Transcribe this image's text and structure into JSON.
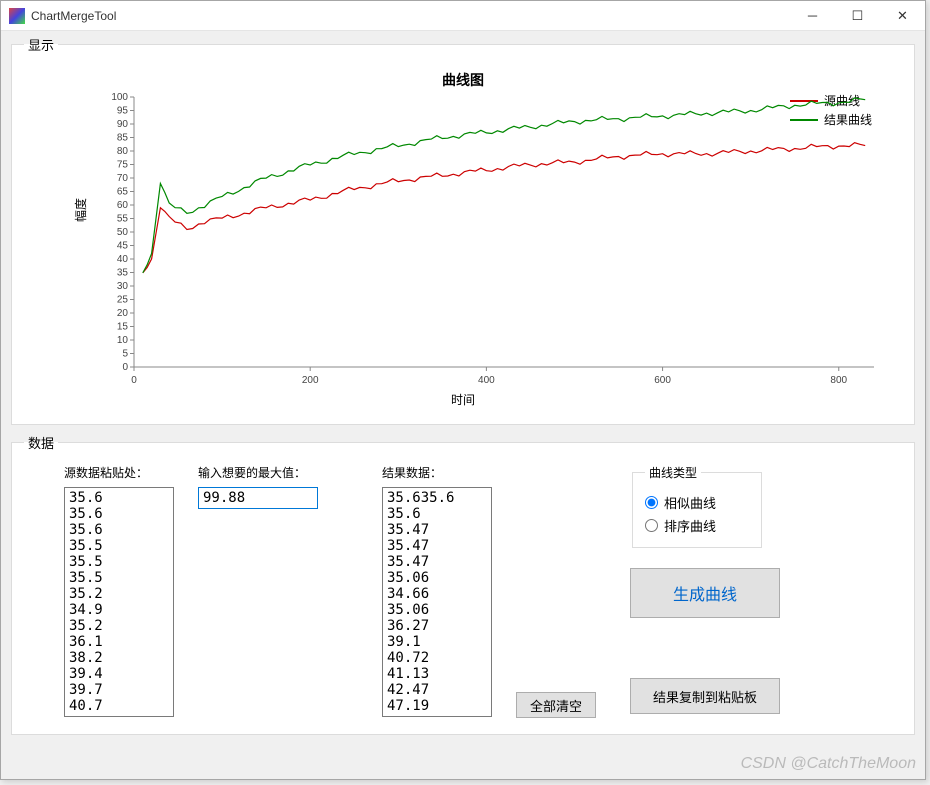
{
  "window": {
    "title": "ChartMergeTool"
  },
  "groups": {
    "display": "显示",
    "data": "数据"
  },
  "chart_data": {
    "type": "line",
    "title": "曲线图",
    "xlabel": "时间",
    "ylabel": "幅度",
    "xlim": [
      0,
      840
    ],
    "ylim": [
      0,
      100
    ],
    "x_ticks": [
      0,
      200,
      400,
      600,
      800
    ],
    "y_ticks": [
      0,
      5,
      10,
      15,
      20,
      25,
      30,
      35,
      40,
      45,
      50,
      55,
      60,
      65,
      70,
      75,
      80,
      85,
      90,
      95,
      100
    ],
    "legend": {
      "series1": "源曲线",
      "series2": "结果曲线",
      "color1": "#cc0000",
      "color2": "#008800"
    },
    "series": [
      {
        "name": "源曲线",
        "color": "#cc0000",
        "x": [
          10,
          20,
          30,
          40,
          60,
          80,
          100,
          150,
          200,
          250,
          300,
          350,
          400,
          450,
          500,
          550,
          600,
          650,
          700,
          750,
          800,
          830
        ],
        "values": [
          35,
          40,
          60,
          55,
          51,
          54,
          55,
          59,
          62,
          66,
          69,
          71,
          73,
          75,
          76,
          78,
          79,
          79,
          80,
          81,
          82,
          82
        ]
      },
      {
        "name": "结果曲线",
        "color": "#008800",
        "x": [
          10,
          20,
          30,
          40,
          60,
          80,
          100,
          150,
          200,
          250,
          300,
          350,
          400,
          450,
          500,
          550,
          600,
          650,
          700,
          750,
          800,
          830
        ],
        "values": [
          35,
          42,
          69,
          60,
          57,
          60,
          63,
          70,
          75,
          79,
          82,
          85,
          87,
          89,
          91,
          92,
          93,
          94,
          95,
          97,
          98,
          99
        ]
      }
    ]
  },
  "data_panel": {
    "source_label": "源数据粘贴处：",
    "max_label": "输入想要的最大值：",
    "result_label": "结果数据：",
    "max_value": "99.88",
    "source_values": "35.6\n35.6\n35.6\n35.5\n35.5\n35.5\n35.2\n34.9\n35.2\n36.1\n38.2\n39.4\n39.7\n40.7",
    "result_values": "35.635.6\n35.6\n35.47\n35.47\n35.47\n35.06\n34.66\n35.06\n36.27\n39.1\n40.72\n41.13\n42.47\n47.19",
    "curve_type_label": "曲线类型",
    "radio_similar": "相似曲线",
    "radio_sort": "排序曲线",
    "btn_generate": "生成曲线",
    "btn_clear": "全部清空",
    "btn_copy": "结果复制到粘贴板"
  },
  "watermark": "CSDN @CatchTheMoon"
}
